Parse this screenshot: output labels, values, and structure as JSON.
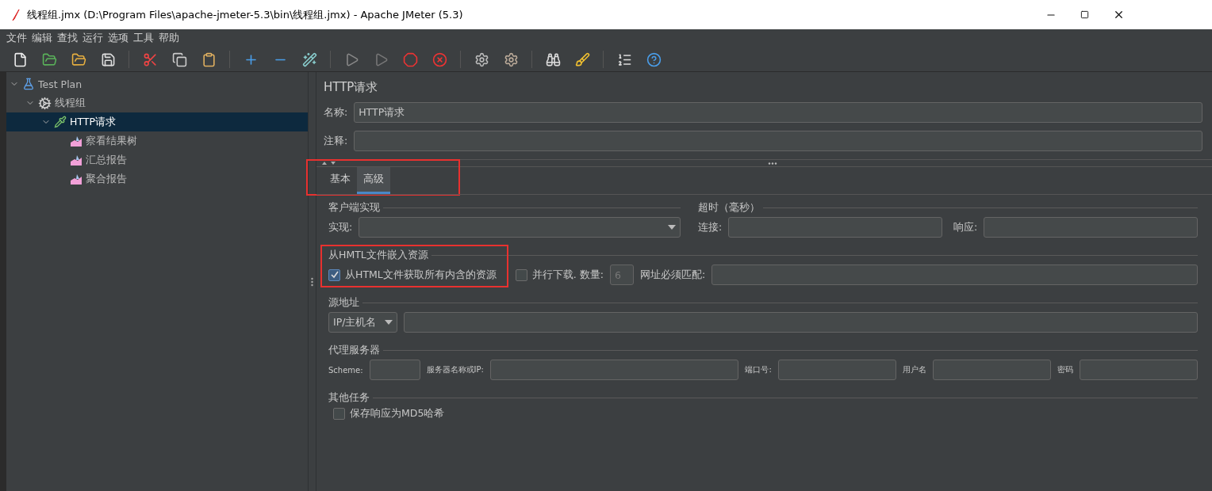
{
  "window": {
    "title": "线程组.jmx (D:\\Program Files\\apache-jmeter-5.3\\bin\\线程组.jmx) - Apache JMeter (5.3)"
  },
  "menu": [
    "文件",
    "编辑",
    "查找",
    "运行",
    "选项",
    "工具",
    "帮助"
  ],
  "tree": [
    {
      "label": "Test Plan",
      "kind": "plan",
      "selected": false,
      "expanded": true,
      "children": [
        {
          "label": "线程组",
          "kind": "threads",
          "selected": false,
          "expanded": true,
          "children": [
            {
              "label": "HTTP请求",
              "kind": "sampler",
              "selected": true,
              "expanded": true,
              "children": [
                {
                  "label": "察看结果树",
                  "kind": "listener",
                  "selected": false
                },
                {
                  "label": "汇总报告",
                  "kind": "listener",
                  "selected": false
                },
                {
                  "label": "聚合报告",
                  "kind": "listener",
                  "selected": false
                }
              ]
            }
          ]
        }
      ]
    }
  ],
  "panel": {
    "title": "HTTP请求",
    "name": {
      "label": "名称:",
      "value": "HTTP请求"
    },
    "comment": {
      "label": "注释:"
    },
    "tabs": {
      "highlighted": true,
      "items": [
        {
          "label": "基本",
          "selected": false
        },
        {
          "label": "高级",
          "selected": true
        }
      ]
    },
    "client": {
      "title": "客户端实现",
      "label": "实现:"
    },
    "timeout": {
      "title": "超时（毫秒）",
      "connect": "连接:",
      "response": "响应:"
    },
    "embedded": {
      "title": "从HMTL文件嵌入资源",
      "highlighted": true,
      "fetch": {
        "label": "从HTML文件获取所有内含的资源",
        "checked": true
      },
      "parallel": {
        "label": "并行下载. 数量:",
        "checked": false
      },
      "count": {
        "value": "6",
        "disabled": true
      },
      "match": {
        "label": "网址必须匹配:"
      }
    },
    "source": {
      "title": "源地址",
      "select": "IP/主机名"
    },
    "proxy": {
      "title": "代理服务器",
      "fields": [
        "Scheme:",
        "服务器名称或IP:",
        "端口号:",
        "用户名",
        "密码"
      ]
    },
    "other": {
      "title": "其他任务",
      "md5": {
        "label": "保存响应为MD5哈希",
        "checked": false
      }
    }
  }
}
